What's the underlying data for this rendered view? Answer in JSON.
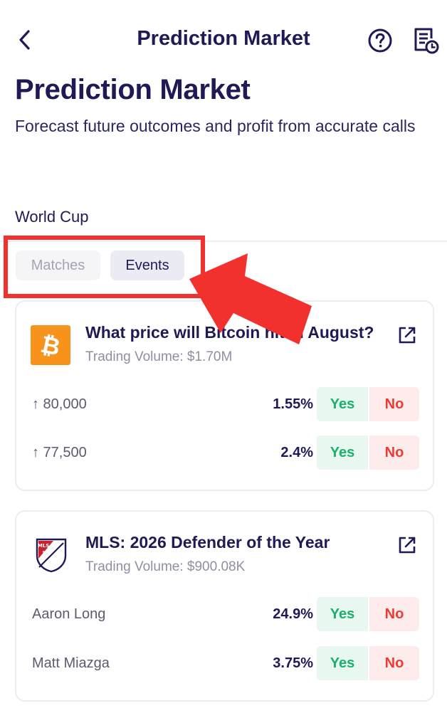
{
  "header": {
    "title": "Prediction Market"
  },
  "page": {
    "title": "Prediction Market",
    "subtitle": "Forecast future outcomes and profit from accurate calls"
  },
  "section": {
    "label": "World Cup"
  },
  "tabs": [
    {
      "label": "Matches",
      "active": false
    },
    {
      "label": "Events",
      "active": true
    }
  ],
  "cards": [
    {
      "icon": "bitcoin-icon",
      "title": "What price will Bitcoin hit in August?",
      "volume": "Trading Volume: $1.70M",
      "rows": [
        {
          "label": "↑ 80,000",
          "pct": "1.55%",
          "yes": "Yes",
          "no": "No"
        },
        {
          "label": "↑ 77,500",
          "pct": "2.4%",
          "yes": "Yes",
          "no": "No"
        }
      ]
    },
    {
      "icon": "mls-logo-icon",
      "logo_text": "MLS",
      "title": "MLS: 2026 Defender of the Year",
      "volume": "Trading Volume: $900.08K",
      "rows": [
        {
          "label": "Aaron Long",
          "pct": "24.9%",
          "yes": "Yes",
          "no": "No"
        },
        {
          "label": "Matt Miazga",
          "pct": "3.75%",
          "yes": "Yes",
          "no": "No"
        }
      ]
    }
  ],
  "colors": {
    "accent": "#1f1a56",
    "yes": "#18b26b",
    "yes_bg": "#e8f7ef",
    "no": "#ee3b33",
    "no_bg": "#fdeceb",
    "bitcoin": "#f7931a",
    "annotation": "#f2312e"
  }
}
